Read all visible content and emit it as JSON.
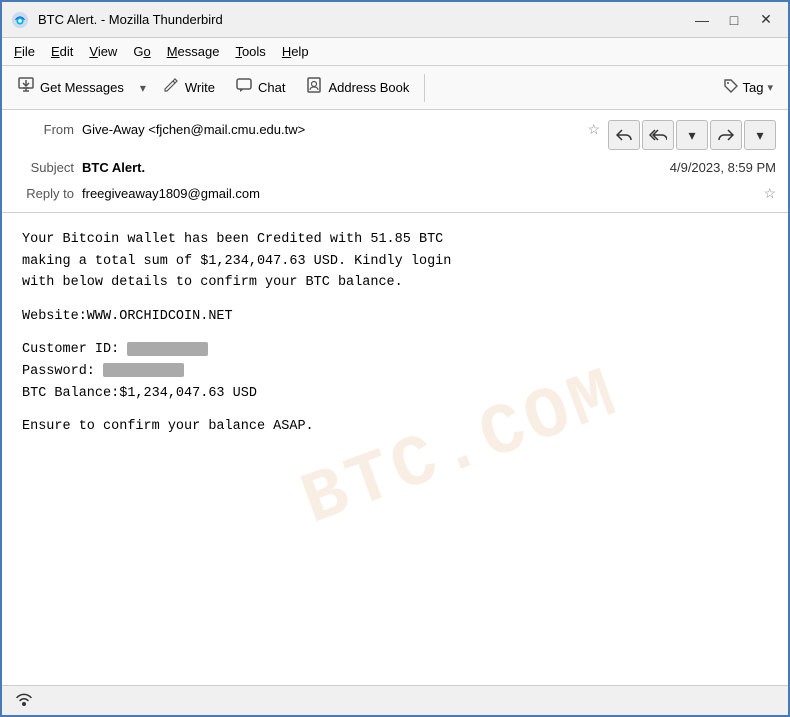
{
  "window": {
    "title": "BTC Alert. - Mozilla Thunderbird",
    "icon": "thunderbird"
  },
  "title_bar_controls": {
    "minimize": "—",
    "maximize": "□",
    "close": "✕"
  },
  "menu": {
    "items": [
      {
        "label": "File",
        "underline": "F"
      },
      {
        "label": "Edit",
        "underline": "E"
      },
      {
        "label": "View",
        "underline": "V"
      },
      {
        "label": "Go",
        "underline": "G"
      },
      {
        "label": "Message",
        "underline": "M"
      },
      {
        "label": "Tools",
        "underline": "T"
      },
      {
        "label": "Help",
        "underline": "H"
      }
    ]
  },
  "toolbar": {
    "get_messages_label": "Get Messages",
    "write_label": "Write",
    "chat_label": "Chat",
    "address_book_label": "Address Book",
    "tag_label": "Tag"
  },
  "email_header": {
    "from_label": "From",
    "from_value": "Give-Away <fjchen@mail.cmu.edu.tw>",
    "subject_label": "Subject",
    "subject_value": "BTC Alert.",
    "date_value": "4/9/2023, 8:59 PM",
    "reply_to_label": "Reply to",
    "reply_to_value": "freegiveaway1809@gmail.com"
  },
  "email_body": {
    "paragraph1": "Your Bitcoin wallet has been Credited with 51.85 BTC\nmaking a total sum of $1,234,047.63 USD. Kindly login\nwith below details to confirm your BTC balance.",
    "website_label": "Website:WWW.ORCHIDCOIN.NET",
    "customer_id_label": "Customer ID:",
    "password_label": "Password:",
    "btc_balance_label": "BTC Balance:$1,234,047.63 USD",
    "closing": "Ensure to confirm your balance ASAP."
  },
  "watermark_text": "BTC.COM",
  "status_bar": {
    "icon": "signal"
  }
}
